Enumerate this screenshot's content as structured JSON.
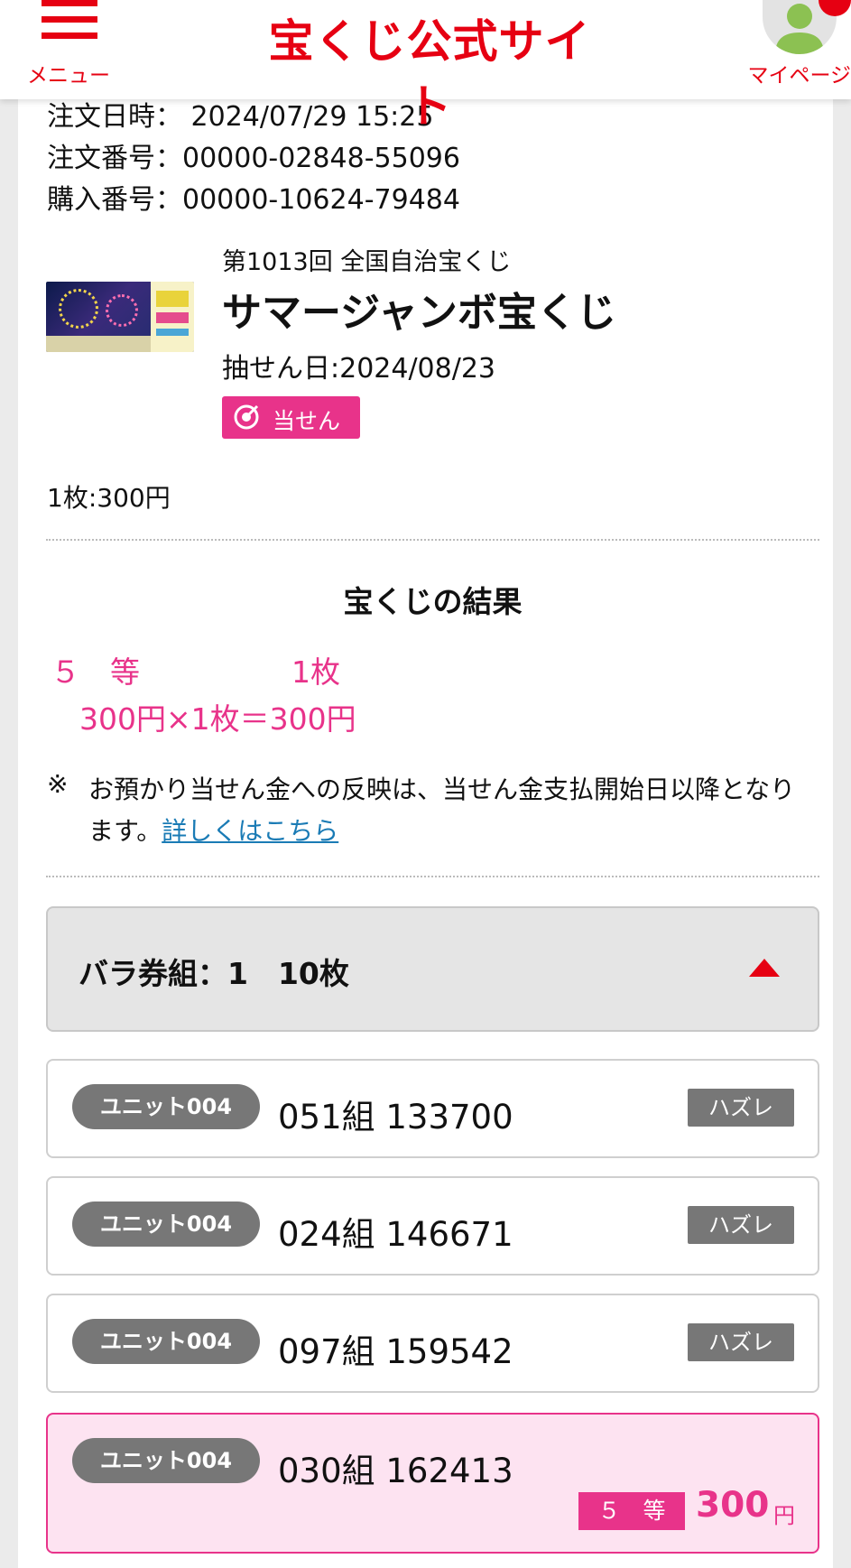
{
  "header": {
    "menu_label": "メニュー",
    "logo_text": "宝くじ公式サイト",
    "mypage_label": "マイページ",
    "accent_color": "#e60012"
  },
  "order": {
    "datetime_label": "注文日時：",
    "datetime_value": "2024/07/29 15:25",
    "order_no_label": "注文番号：",
    "order_no_value": "00000-02848-55096",
    "purchase_no_label": "購入番号：",
    "purchase_no_value": "00000-10624-79484"
  },
  "lottery": {
    "issue": "第1013回 全国自治宝くじ",
    "name": "サマージャンボ宝くじ",
    "draw_date": "抽せん日:2024/08/23",
    "status_badge": "当せん",
    "price": "1枚:300円"
  },
  "result": {
    "title": "宝くじの結果",
    "grade": "５　等",
    "count": "1枚",
    "calc": "300円×1枚＝300円",
    "note_mark": "※",
    "note_text": "お預かり当せん金への反映は、当せん金支払開始日以降となります。",
    "note_link": "詳しくはこちら",
    "highlight_color": "#e8338a"
  },
  "group": {
    "label": "バラ券組：1　10枚"
  },
  "tickets": [
    {
      "unit": "ユニット004",
      "number": "051組  133700",
      "status": "ハズレ"
    },
    {
      "unit": "ユニット004",
      "number": "024組  146671",
      "status": "ハズレ"
    },
    {
      "unit": "ユニット004",
      "number": "097組  159542",
      "status": "ハズレ"
    },
    {
      "unit": "ユニット004",
      "number": "030組  162413",
      "prize_grade": "５　等",
      "prize_amount": "300",
      "prize_unit": "円"
    }
  ]
}
